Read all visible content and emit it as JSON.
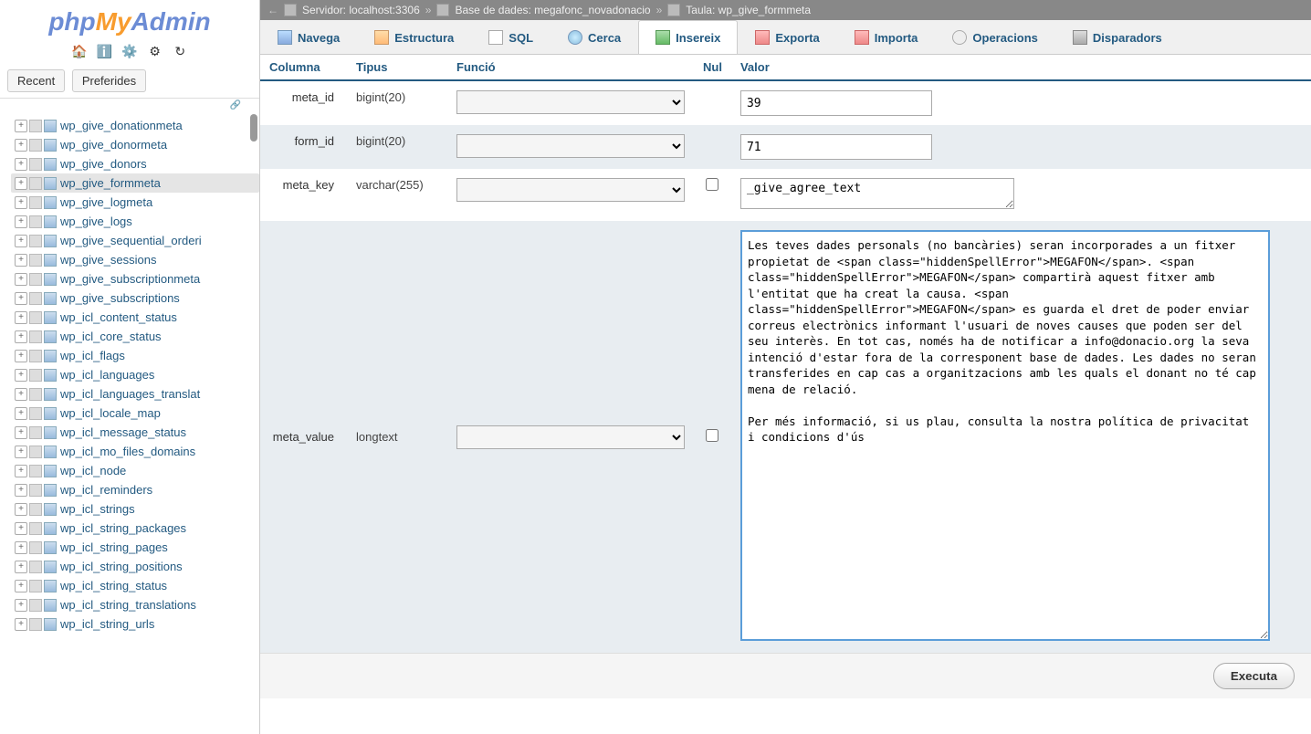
{
  "logo": {
    "p1": "php",
    "p2": "My",
    "p3": "Admin"
  },
  "quick_icons": [
    "🏠",
    "ℹ️",
    "⚙️",
    "⚙",
    "↻"
  ],
  "recent_tabs": {
    "recent": "Recent",
    "pref": "Preferides"
  },
  "breadcrumb": {
    "arrow": "←",
    "server_label": "Servidor: localhost:3306",
    "db_label": "Base de dades: megafonc_novadonacio",
    "table_label": "Taula: wp_give_formmeta",
    "sep": "»"
  },
  "tabs": [
    {
      "key": "browse",
      "label": "Navega",
      "ic": "ic-browse"
    },
    {
      "key": "struct",
      "label": "Estructura",
      "ic": "ic-struct"
    },
    {
      "key": "sql",
      "label": "SQL",
      "ic": "ic-sql"
    },
    {
      "key": "search",
      "label": "Cerca",
      "ic": "ic-search"
    },
    {
      "key": "insert",
      "label": "Insereix",
      "ic": "ic-insert",
      "active": true
    },
    {
      "key": "export",
      "label": "Exporta",
      "ic": "ic-export"
    },
    {
      "key": "import",
      "label": "Importa",
      "ic": "ic-import"
    },
    {
      "key": "ops",
      "label": "Operacions",
      "ic": "ic-ops"
    },
    {
      "key": "trig",
      "label": "Disparadors",
      "ic": "ic-trig"
    }
  ],
  "headers": {
    "col": "Columna",
    "type": "Tipus",
    "func": "Funció",
    "null": "Nul",
    "val": "Valor"
  },
  "rows": [
    {
      "name": "meta_id",
      "type": "bigint(20)",
      "val": "39",
      "null": false,
      "input": "text"
    },
    {
      "name": "form_id",
      "type": "bigint(20)",
      "val": "71",
      "null": false,
      "input": "text"
    },
    {
      "name": "meta_key",
      "type": "varchar(255)",
      "val": "_give_agree_text",
      "null": true,
      "input": "ta-sm"
    },
    {
      "name": "meta_value",
      "type": "longtext",
      "val": "Les teves dades personals (no bancàries) seran incorporades a un fitxer propietat de <span class=\"hiddenSpellError\">MEGAFON</span>. <span class=\"hiddenSpellError\">MEGAFON</span> compartirà aquest fitxer amb l'entitat que ha creat la causa. <span class=\"hiddenSpellError\">MEGAFON</span> es guarda el dret de poder enviar correus electrònics informant l'usuari de noves causes que poden ser del seu interès. En tot cas, només ha de notificar a info@donacio.org la seva intenció d'estar fora de la corresponent base de dades. Les dades no seran transferides en cap cas a organitzacions amb les quals el donant no té cap mena de relació.\n\nPer més informació, si us plau, consulta la nostra política de privacitat i condicions d'ús",
      "null": true,
      "input": "ta-lg"
    }
  ],
  "tree_items": [
    {
      "label": "wp_give_donationmeta"
    },
    {
      "label": "wp_give_donormeta"
    },
    {
      "label": "wp_give_donors"
    },
    {
      "label": "wp_give_formmeta",
      "active": true
    },
    {
      "label": "wp_give_logmeta"
    },
    {
      "label": "wp_give_logs"
    },
    {
      "label": "wp_give_sequential_orderi"
    },
    {
      "label": "wp_give_sessions"
    },
    {
      "label": "wp_give_subscriptionmeta"
    },
    {
      "label": "wp_give_subscriptions"
    },
    {
      "label": "wp_icl_content_status"
    },
    {
      "label": "wp_icl_core_status"
    },
    {
      "label": "wp_icl_flags"
    },
    {
      "label": "wp_icl_languages"
    },
    {
      "label": "wp_icl_languages_translat"
    },
    {
      "label": "wp_icl_locale_map"
    },
    {
      "label": "wp_icl_message_status"
    },
    {
      "label": "wp_icl_mo_files_domains"
    },
    {
      "label": "wp_icl_node"
    },
    {
      "label": "wp_icl_reminders"
    },
    {
      "label": "wp_icl_strings"
    },
    {
      "label": "wp_icl_string_packages"
    },
    {
      "label": "wp_icl_string_pages"
    },
    {
      "label": "wp_icl_string_positions"
    },
    {
      "label": "wp_icl_string_status"
    },
    {
      "label": "wp_icl_string_translations"
    },
    {
      "label": "wp_icl_string_urls"
    }
  ],
  "exec_label": "Executa"
}
